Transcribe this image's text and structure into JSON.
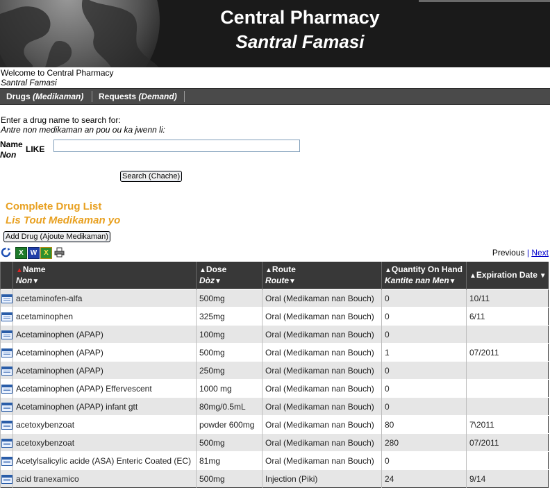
{
  "header": {
    "title": "Central Pharmacy",
    "subtitle": "Santral Famasi"
  },
  "welcome": {
    "line1": "Welcome to Central Pharmacy",
    "line2": "Santral Famasi"
  },
  "nav": [
    {
      "label": "Drugs",
      "label_alt": "(Medikaman)"
    },
    {
      "label": "Requests",
      "label_alt": "(Demand)"
    }
  ],
  "search": {
    "prompt": "Enter a drug name to search for:",
    "prompt_alt": "Antre non medikaman an pou ou ka jwenn li:",
    "field_label": "Name",
    "field_label_alt": "Non",
    "operator": "LIKE",
    "value": "",
    "button": "Search (Chache)"
  },
  "list": {
    "title": "Complete Drug List",
    "title_alt": "Lis Tout Medikaman yo",
    "add_button": "Add Drug (Ajoute Medikaman)"
  },
  "toolbar_icons": [
    "refresh-icon",
    "excel-icon",
    "word-icon",
    "excel-export-icon",
    "print-icon"
  ],
  "pager": {
    "previous": "Previous",
    "separator": "|",
    "next": "Next"
  },
  "columns": [
    {
      "label": "Name",
      "label_alt": "Non"
    },
    {
      "label": "Dose",
      "label_alt": "Dòz"
    },
    {
      "label": "Route",
      "label_alt": "Route"
    },
    {
      "label": "Quantity On Hand",
      "label_alt": "Kantite nan Men"
    },
    {
      "label": "Expiration Date",
      "label_alt": ""
    }
  ],
  "rows": [
    {
      "name": "acetaminofen-alfa",
      "dose": "500mg",
      "route": "Oral (Medikaman nan Bouch)",
      "qty": "0",
      "exp": "10/11"
    },
    {
      "name": "acetaminophen",
      "dose": "325mg",
      "route": "Oral (Medikaman nan Bouch)",
      "qty": "0",
      "exp": "6/11"
    },
    {
      "name": "Acetaminophen (APAP)",
      "dose": "100mg",
      "route": "Oral (Medikaman nan Bouch)",
      "qty": "0",
      "exp": ""
    },
    {
      "name": "Acetaminophen (APAP)",
      "dose": "500mg",
      "route": "Oral (Medikaman nan Bouch)",
      "qty": "1",
      "exp": "07/2011"
    },
    {
      "name": "Acetaminophen (APAP)",
      "dose": "250mg",
      "route": "Oral (Medikaman nan Bouch)",
      "qty": "0",
      "exp": ""
    },
    {
      "name": "Acetaminophen (APAP) Effervescent",
      "dose": "1000 mg",
      "route": "Oral (Medikaman nan Bouch)",
      "qty": "0",
      "exp": ""
    },
    {
      "name": "Acetaminophen (APAP) infant gtt",
      "dose": "80mg/0.5mL",
      "route": "Oral (Medikaman nan Bouch)",
      "qty": "0",
      "exp": ""
    },
    {
      "name": "acetoxybenzoat",
      "dose": "powder 600mg",
      "route": "Oral (Medikaman nan Bouch)",
      "qty": "80",
      "exp": "7\\2011"
    },
    {
      "name": "acetoxybenzoat",
      "dose": "500mg",
      "route": "Oral (Medikaman nan Bouch)",
      "qty": "280",
      "exp": "07/2011"
    },
    {
      "name": "Acetylsalicylic acide (ASA) Enteric Coated (EC)",
      "dose": "81mg",
      "route": "Oral (Medikaman nan Bouch)",
      "qty": "0",
      "exp": ""
    },
    {
      "name": "acid tranexamico",
      "dose": "500mg",
      "route": "Injection (Piki)",
      "qty": "24",
      "exp": "9/14"
    }
  ]
}
